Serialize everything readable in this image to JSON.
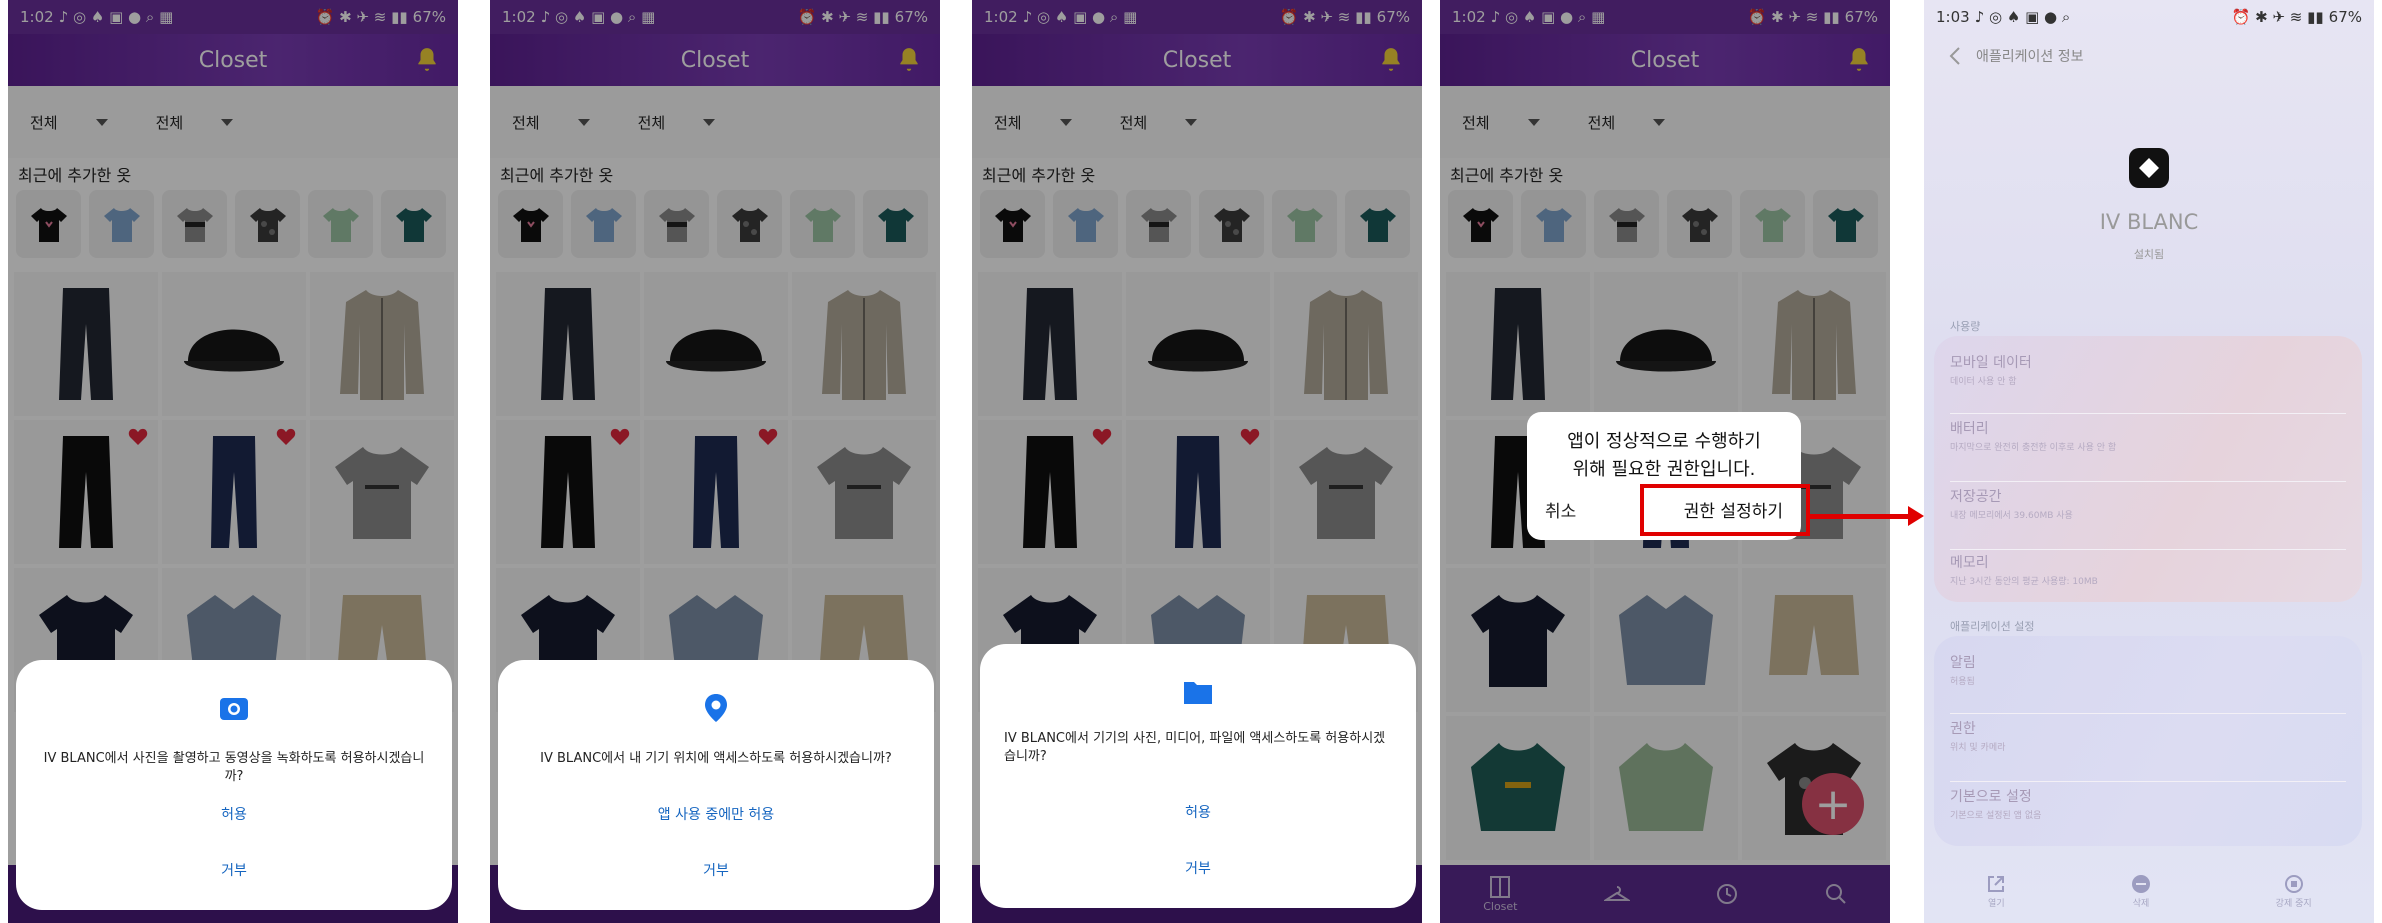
{
  "status": {
    "time_a": "1:02",
    "time_b": "1:03",
    "battery": "67%"
  },
  "closet": {
    "title": "Closet",
    "filter1": "전체",
    "filter2": "전체",
    "recent_title": "최근에 추가한 옷",
    "nav_label": "Closet"
  },
  "dialogs": {
    "camera": {
      "message": "IV BLANC에서 사진을 촬영하고 동영상을 녹화하도록 허용하시겠습니까?",
      "allow": "허용",
      "deny": "거부"
    },
    "location": {
      "message": "IV BLANC에서 내 기기 위치에 액세스하도록 허용하시겠습니까?",
      "allow": "앱 사용 중에만 허용",
      "deny": "거부"
    },
    "storage": {
      "message": "IV BLANC에서 기기의 사진, 미디어, 파일에 액세스하도록 허용하시겠습니까?",
      "allow": "허용",
      "deny": "거부"
    },
    "permission": {
      "line1": "앱이 정상적으로 수행하기",
      "line2": "위해 필요한 권한입니다.",
      "cancel": "취소",
      "settings": "권한 설정하기"
    }
  },
  "settings": {
    "back_title": "애플리케이션 정보",
    "app_name": "IV BLANC",
    "installed": "설치됨",
    "usage_title": "사용량",
    "usage_items": [
      {
        "title": "모바일 데이터",
        "sub": "데이터 사용 안 함"
      },
      {
        "title": "배터리",
        "sub": "마지막으로 완전히 충전한 이후로 사용 안 함"
      },
      {
        "title": "저장공간",
        "sub": "내장 메모리에서 39.60MB 사용"
      },
      {
        "title": "메모리",
        "sub": "지난 3시간 동안의 평균 사용량: 10MB"
      }
    ],
    "appset_title": "애플리케이션 설정",
    "appset_items": [
      {
        "title": "알림",
        "sub": "허용됨"
      },
      {
        "title": "권한",
        "sub": "위치 및 카메라"
      },
      {
        "title": "기본으로 설정",
        "sub": "기본으로 설정된 앱 없음"
      }
    ],
    "bottom": {
      "open": "열기",
      "uninstall": "삭제",
      "force_stop": "강제 중지"
    }
  },
  "colors": {
    "purple_bar": "#6a2f9c",
    "dialog_button_blue": "#1565c0",
    "highlight_red": "#e00000",
    "fab_pink": "#d94f6b"
  }
}
